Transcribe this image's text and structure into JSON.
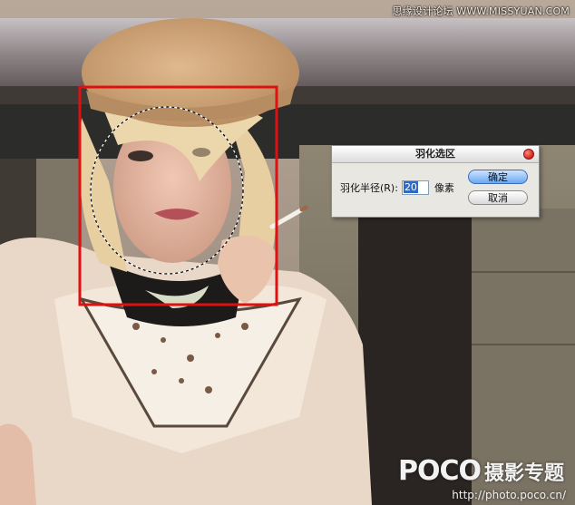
{
  "watermark": {
    "top_text": "思缘设计论坛 WWW.MISSYUAN.COM",
    "brand": "POCO",
    "brand_cn": "摄影专题",
    "url": "http://photo.poco.cn/"
  },
  "dialog": {
    "title": "羽化选区",
    "radius_label": "羽化半径(R):",
    "radius_value": "20",
    "unit": "像素",
    "ok_label": "确定",
    "cancel_label": "取消"
  },
  "selection": {
    "rect_color": "#e01010"
  }
}
